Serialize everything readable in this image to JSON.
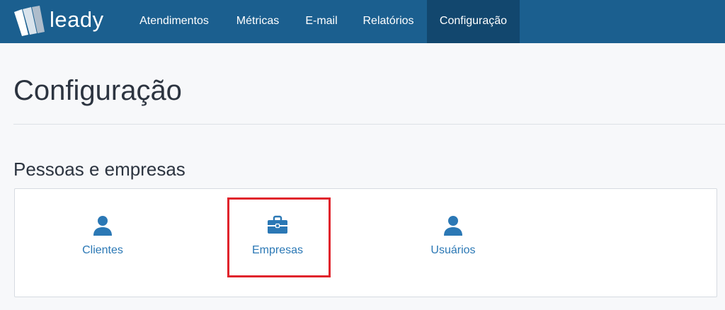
{
  "brand": {
    "name": "leady",
    "logo_icon": "leady-logo-icon"
  },
  "nav": {
    "items": [
      {
        "label": "Atendimentos"
      },
      {
        "label": "Métricas"
      },
      {
        "label": "E-mail"
      },
      {
        "label": "Relatórios"
      },
      {
        "label": "Configuração",
        "active": true
      }
    ]
  },
  "page": {
    "title": "Configuração",
    "sections": [
      {
        "title": "Pessoas e empresas",
        "tiles": [
          {
            "label": "Clientes",
            "icon": "user-icon"
          },
          {
            "label": "Empresas",
            "icon": "briefcase-icon",
            "highlighted": true
          },
          {
            "label": "Usuários",
            "icon": "user-icon"
          }
        ]
      }
    ]
  },
  "colors": {
    "navbar": "#1b5f8f",
    "navbar_active": "#12476e",
    "link": "#2b78b5",
    "highlight": "#e0242c"
  }
}
